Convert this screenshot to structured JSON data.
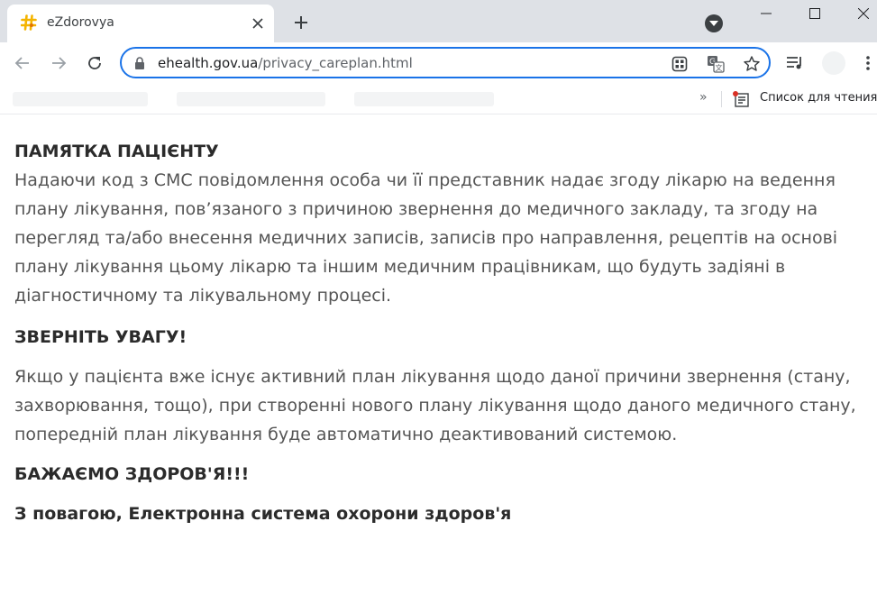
{
  "browser": {
    "tab": {
      "title": "eZdorovya",
      "favicon": "hash-favicon-icon"
    },
    "address_bar": {
      "host": "ehealth.gov.ua",
      "path": "/privacy_careplan.html"
    },
    "bookmarks_bar": {
      "more": "»",
      "reading_list_label": "Список для чтения"
    }
  },
  "page": {
    "title": "ПАМЯТКА ПАЦІЄНТУ",
    "intro": "Надаючи код з СМС повідомлення особа чи її представник надає згоду лікарю на ведення плану лікування, пов’язаного з причиною звернення до медичного закладу, та згоду на перегляд та/або внесення медичних записів, записів про направлення, рецептів на основі плану лікування цьому лікарю та іншим медичним працівникам, що будуть задіяні в діагностичному та лікувальному процесі.",
    "attention_heading": "ЗВЕРНІТЬ УВАГУ!",
    "attention_text": "Якщо у пацієнта вже існує активний план лікування щодо даної причини звернення (стану, захворювання, тощо), при створенні нового плану лікування щодо даного медичного стану, попередній план лікування буде автоматично деактивований системою.",
    "wish": "БАЖАЄМО ЗДОРОВ'Я!!!",
    "signature": "З повагою, Електронна система охорони здоров'я"
  },
  "colors": {
    "tabstrip_bg": "#dee1e6",
    "omnibox_border": "#1a73e8",
    "heading_text": "#2b2b2b",
    "body_text": "#555555",
    "favicon": "#f4b400"
  }
}
